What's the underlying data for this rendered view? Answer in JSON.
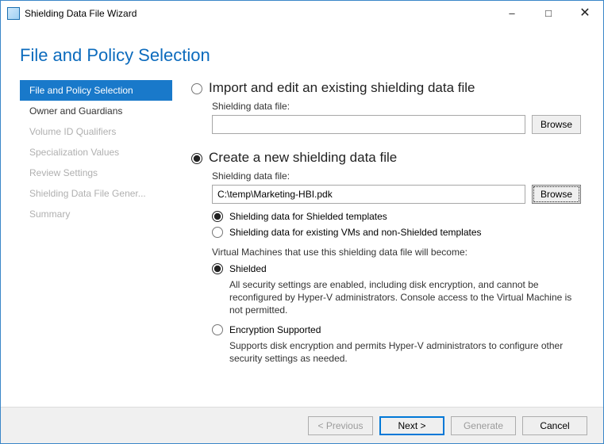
{
  "window": {
    "title": "Shielding Data File Wizard"
  },
  "page": {
    "title": "File and Policy Selection"
  },
  "sidebar": {
    "items": [
      {
        "label": "File and Policy Selection"
      },
      {
        "label": "Owner and Guardians"
      },
      {
        "label": "Volume ID Qualifiers"
      },
      {
        "label": "Specialization Values"
      },
      {
        "label": "Review Settings"
      },
      {
        "label": "Shielding Data File Gener..."
      },
      {
        "label": "Summary"
      }
    ]
  },
  "main": {
    "import": {
      "heading": "Import and edit an existing shielding data file",
      "file_label": "Shielding data file:",
      "file_value": "",
      "browse": "Browse"
    },
    "create": {
      "heading": "Create a new shielding data file",
      "file_label": "Shielding data file:",
      "file_value": "C:\\temp\\Marketing-HBI.pdk",
      "browse": "Browse",
      "opt_shielded_templates": "Shielding data for Shielded templates",
      "opt_existing_vms": "Shielding data for existing VMs and non-Shielded templates",
      "note": "Virtual Machines that use this shielding data file will become:",
      "shielded_label": "Shielded",
      "shielded_desc": "All security settings are enabled, including disk encryption, and cannot be reconfigured by Hyper-V administrators. Console access to the Virtual Machine is not permitted.",
      "enc_label": "Encryption Supported",
      "enc_desc": "Supports disk encryption and permits Hyper-V administrators to configure other security settings as needed."
    }
  },
  "footer": {
    "previous": "< Previous",
    "next": "Next >",
    "generate": "Generate",
    "cancel": "Cancel"
  }
}
